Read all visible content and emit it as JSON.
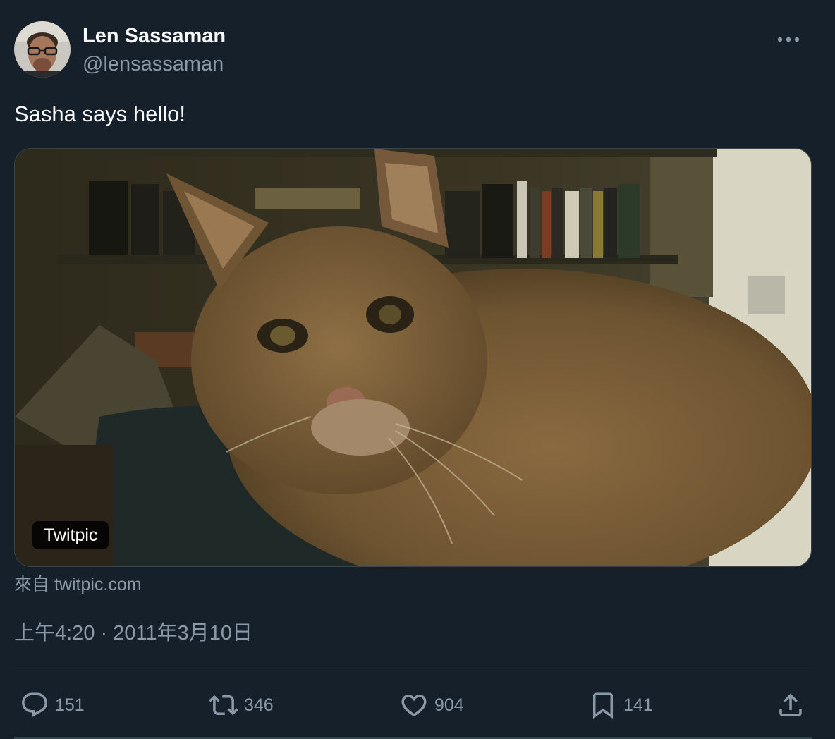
{
  "author": {
    "display_name": "Len Sassaman",
    "handle": "@lensassaman"
  },
  "tweet": {
    "text": "Sasha says hello!",
    "media_badge": "Twitpic",
    "source": "來自 twitpic.com",
    "timestamp": "上午4:20 · 2011年3月10日"
  },
  "actions": {
    "replies": "151",
    "retweets": "346",
    "likes": "904",
    "bookmarks": "141"
  },
  "icons": {
    "more": "more-horizontal-icon",
    "reply": "reply-icon",
    "retweet": "retweet-icon",
    "like": "heart-icon",
    "bookmark": "bookmark-icon",
    "share": "share-icon"
  },
  "colors": {
    "background": "#15202b",
    "primary_text": "#f7f9f9",
    "secondary_text": "#8b98a5",
    "border": "#38444d"
  }
}
